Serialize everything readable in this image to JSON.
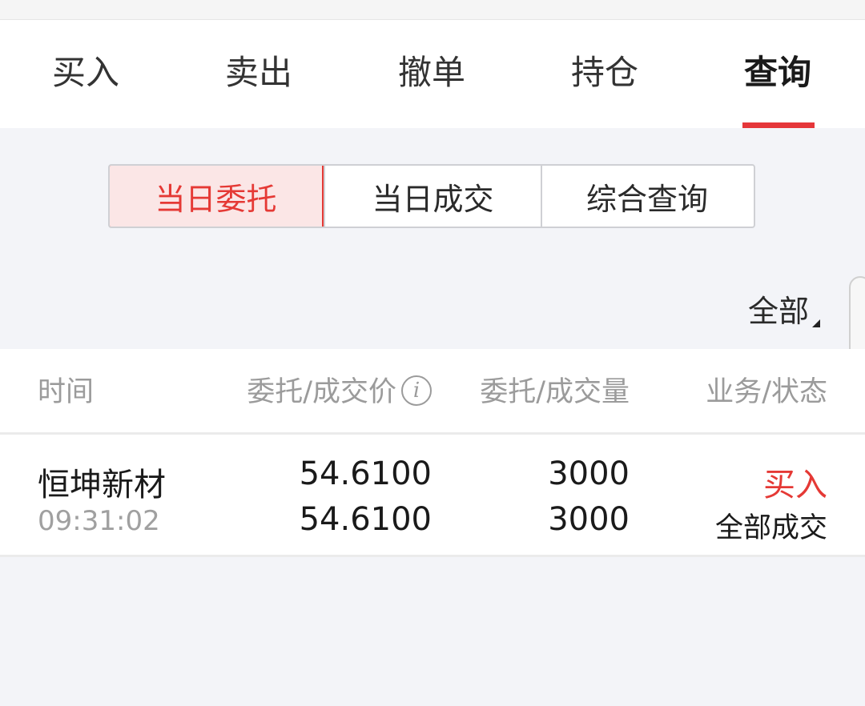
{
  "tabs": [
    {
      "label": "买入"
    },
    {
      "label": "卖出"
    },
    {
      "label": "撤单"
    },
    {
      "label": "持仓"
    },
    {
      "label": "查询",
      "active": true
    }
  ],
  "segments": [
    {
      "label": "当日委托",
      "active": true
    },
    {
      "label": "当日成交"
    },
    {
      "label": "综合查询"
    }
  ],
  "filter": {
    "label": "全部"
  },
  "columns": {
    "time": "时间",
    "price": "委托/成交价",
    "qty": "委托/成交量",
    "status": "业务/状态"
  },
  "icons": {
    "info": "info-icon",
    "filter": "dropdown-triangle-icon"
  },
  "orders": [
    {
      "name": "恒坤新材",
      "time": "09:31:02",
      "order_price": "54.6100",
      "deal_price": "54.6100",
      "order_qty": "3000",
      "deal_qty": "3000",
      "side": "买入",
      "status": "全部成交"
    }
  ],
  "colors": {
    "accent": "#e53935",
    "accent_bg": "#fbe6e6",
    "page_bg": "#f3f4f8"
  }
}
